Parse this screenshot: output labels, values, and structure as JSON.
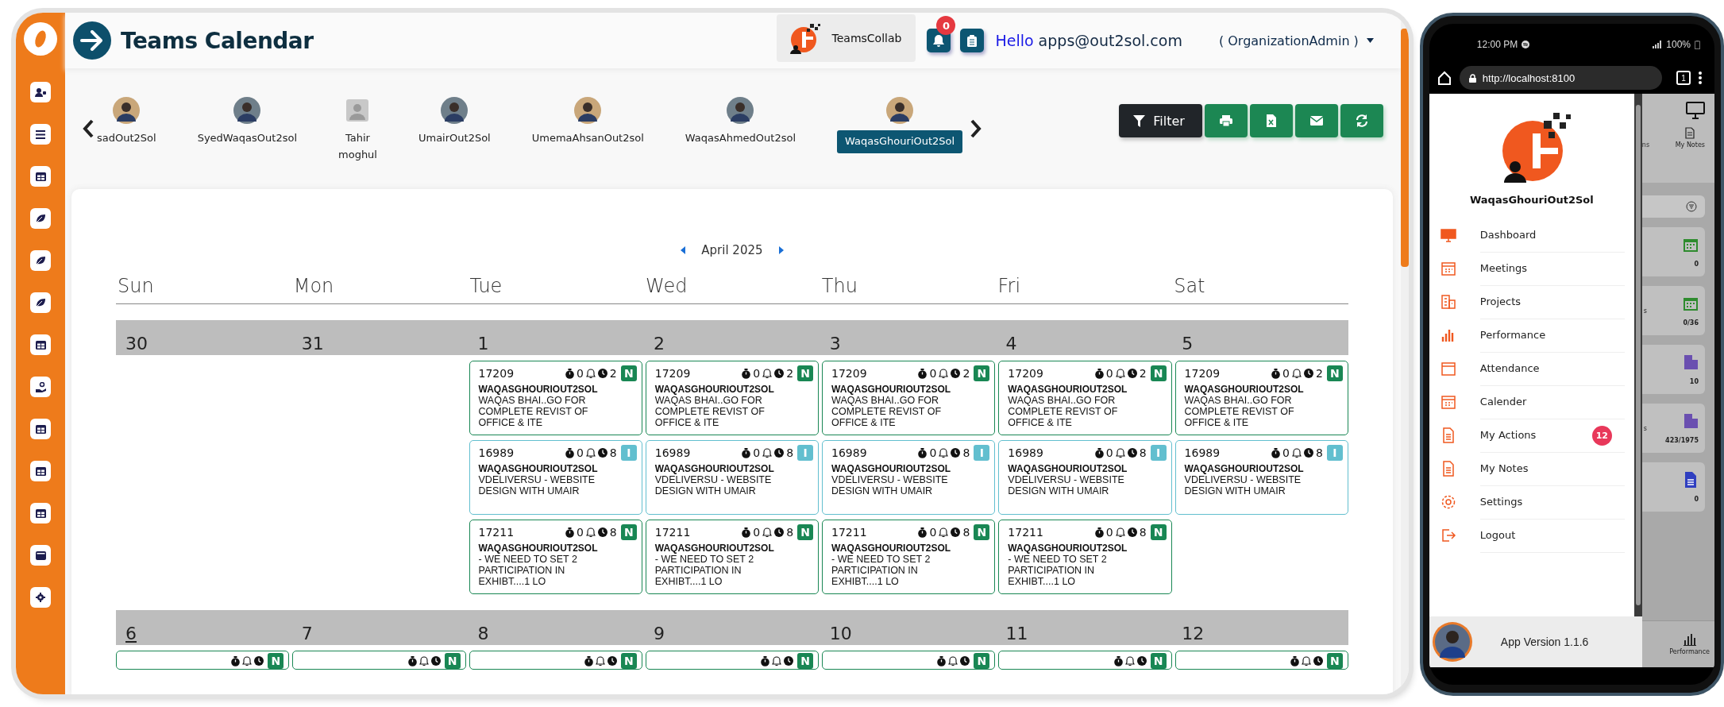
{
  "header": {
    "title": "Teams Calendar",
    "app_name": "TeamsCollab",
    "notification_count": "0",
    "greeting": "Hello",
    "email": "apps@out2sol.com",
    "role": "( OrganizationAdmin )"
  },
  "members": [
    {
      "name": "sadOut2Sol",
      "placeholder_avatar": false,
      "selected": false
    },
    {
      "name": "SyedWaqasOut2sol",
      "placeholder_avatar": false,
      "selected": false
    },
    {
      "name": "Tahir moghul",
      "placeholder_avatar": true,
      "selected": false
    },
    {
      "name": "UmairOut2Sol",
      "placeholder_avatar": false,
      "selected": false
    },
    {
      "name": "UmemaAhsanOut2sol",
      "placeholder_avatar": false,
      "selected": false
    },
    {
      "name": "WaqasAhmedOut2sol",
      "placeholder_avatar": false,
      "selected": false
    },
    {
      "name": "WaqasGhouriOut2Sol",
      "placeholder_avatar": false,
      "selected": true
    }
  ],
  "toolbar": {
    "filter": "Filter"
  },
  "calendar": {
    "month": "April 2025",
    "weekdays": [
      "Sun",
      "Mon",
      "Tue",
      "Wed",
      "Thu",
      "Fri",
      "Sat"
    ],
    "weeks": [
      {
        "days": [
          {
            "date": "30",
            "today": false
          },
          {
            "date": "31",
            "today": false
          },
          {
            "date": "1",
            "today": false,
            "events": [
              {
                "id": "17209",
                "timer": "0",
                "clock": "2",
                "badge": "N",
                "color": "#198754",
                "owner": "WAQASGHOURIOUT2SOL",
                "description": "WAQAS BHAI..GO FOR COMPLETE REVIST OF OFFICE & ITE"
              },
              {
                "id": "16989",
                "timer": "0",
                "clock": "8",
                "badge": "I",
                "color": "#62bfcf",
                "owner": "WAQASGHOURIOUT2SOL",
                "description": "VDELIVERSU - WEBSITE DESIGN WITH UMAIR"
              },
              {
                "id": "17211",
                "timer": "0",
                "clock": "8",
                "badge": "N",
                "color": "#198754",
                "owner": "WAQASGHOURIOUT2SOL",
                "description": "- WE NEED TO SET 2 PARTICIPATION IN EXHIBT....1 LO"
              }
            ]
          },
          {
            "date": "2",
            "today": false,
            "events": [
              {
                "id": "17209",
                "timer": "0",
                "clock": "2",
                "badge": "N",
                "color": "#198754",
                "owner": "WAQASGHOURIOUT2SOL",
                "description": "WAQAS BHAI..GO FOR COMPLETE REVIST OF OFFICE & ITE"
              },
              {
                "id": "16989",
                "timer": "0",
                "clock": "8",
                "badge": "I",
                "color": "#62bfcf",
                "owner": "WAQASGHOURIOUT2SOL",
                "description": "VDELIVERSU - WEBSITE DESIGN WITH UMAIR"
              },
              {
                "id": "17211",
                "timer": "0",
                "clock": "8",
                "badge": "N",
                "color": "#198754",
                "owner": "WAQASGHOURIOUT2SOL",
                "description": "- WE NEED TO SET 2 PARTICIPATION IN EXHIBT....1 LO"
              }
            ]
          },
          {
            "date": "3",
            "today": false,
            "events": [
              {
                "id": "17209",
                "timer": "0",
                "clock": "2",
                "badge": "N",
                "color": "#198754",
                "owner": "WAQASGHOURIOUT2SOL",
                "description": "WAQAS BHAI..GO FOR COMPLETE REVIST OF OFFICE & ITE"
              },
              {
                "id": "16989",
                "timer": "0",
                "clock": "8",
                "badge": "I",
                "color": "#62bfcf",
                "owner": "WAQASGHOURIOUT2SOL",
                "description": "VDELIVERSU - WEBSITE DESIGN WITH UMAIR"
              },
              {
                "id": "17211",
                "timer": "0",
                "clock": "8",
                "badge": "N",
                "color": "#198754",
                "owner": "WAQASGHOURIOUT2SOL",
                "description": "- WE NEED TO SET 2 PARTICIPATION IN EXHIBT....1 LO"
              }
            ]
          },
          {
            "date": "4",
            "today": false,
            "events": [
              {
                "id": "17209",
                "timer": "0",
                "clock": "2",
                "badge": "N",
                "color": "#198754",
                "owner": "WAQASGHOURIOUT2SOL",
                "description": "WAQAS BHAI..GO FOR COMPLETE REVIST OF OFFICE & ITE"
              },
              {
                "id": "16989",
                "timer": "0",
                "clock": "8",
                "badge": "I",
                "color": "#62bfcf",
                "owner": "WAQASGHOURIOUT2SOL",
                "description": "VDELIVERSU - WEBSITE DESIGN WITH UMAIR"
              },
              {
                "id": "17211",
                "timer": "0",
                "clock": "8",
                "badge": "N",
                "color": "#198754",
                "owner": "WAQASGHOURIOUT2SOL",
                "description": "- WE NEED TO SET 2 PARTICIPATION IN EXHIBT....1 LO"
              }
            ]
          },
          {
            "date": "5",
            "today": false,
            "events": [
              {
                "id": "17209",
                "timer": "0",
                "clock": "2",
                "badge": "N",
                "color": "#198754",
                "owner": "WAQASGHOURIOUT2SOL",
                "description": "WAQAS BHAI..GO FOR COMPLETE REVIST OF OFFICE & ITE"
              },
              {
                "id": "16989",
                "timer": "0",
                "clock": "8",
                "badge": "I",
                "color": "#62bfcf",
                "owner": "WAQASGHOURIOUT2SOL",
                "description": "VDELIVERSU - WEBSITE DESIGN WITH UMAIR"
              }
            ]
          }
        ]
      },
      {
        "days": [
          {
            "date": "6",
            "today": true,
            "events": [
              {
                "badge": "N",
                "color": "#198754"
              }
            ]
          },
          {
            "date": "7",
            "today": false,
            "events": [
              {
                "badge": "N",
                "color": "#198754"
              }
            ]
          },
          {
            "date": "8",
            "today": false,
            "events": [
              {
                "badge": "N",
                "color": "#198754"
              }
            ]
          },
          {
            "date": "9",
            "today": false,
            "events": [
              {
                "badge": "N",
                "color": "#198754"
              }
            ]
          },
          {
            "date": "10",
            "today": false,
            "events": [
              {
                "badge": "N",
                "color": "#198754"
              }
            ]
          },
          {
            "date": "11",
            "today": false,
            "events": [
              {
                "badge": "N",
                "color": "#198754"
              }
            ]
          },
          {
            "date": "12",
            "today": false,
            "events": [
              {
                "badge": "N",
                "color": "#198754"
              }
            ]
          }
        ]
      }
    ]
  },
  "phone": {
    "time": "12:00 PM",
    "battery": "100%",
    "url": "http://localhost:8100",
    "tab_count": "1",
    "drawer": {
      "user_name": "WaqasGhouriOut2Sol",
      "menu": [
        {
          "label": "Dashboard"
        },
        {
          "label": "Meetings"
        },
        {
          "label": "Projects"
        },
        {
          "label": "Performance"
        },
        {
          "label": "Attendance"
        },
        {
          "label": "Calender"
        },
        {
          "label": "My Actions",
          "badge": "12"
        },
        {
          "label": "My Notes"
        },
        {
          "label": "Settings"
        },
        {
          "label": "Logout"
        }
      ],
      "app_version": "App Version 1.1.6"
    },
    "background": {
      "tabs": [
        "ns",
        "My Notes"
      ],
      "cards": [
        {
          "kind": "calendar",
          "color": "#2e8b2e",
          "value": "0"
        },
        {
          "kind": "calendar",
          "color": "#2e8b2e",
          "fragment": "s",
          "value": "0/36"
        },
        {
          "kind": "building",
          "color": "#6a4fb0",
          "value": "10"
        },
        {
          "kind": "building",
          "color": "#6a4fb0",
          "fragment": "s",
          "value": "423/1975"
        },
        {
          "kind": "document",
          "color": "#2f3fc0",
          "value": "0"
        }
      ],
      "bottom_tab": "Performance"
    }
  }
}
